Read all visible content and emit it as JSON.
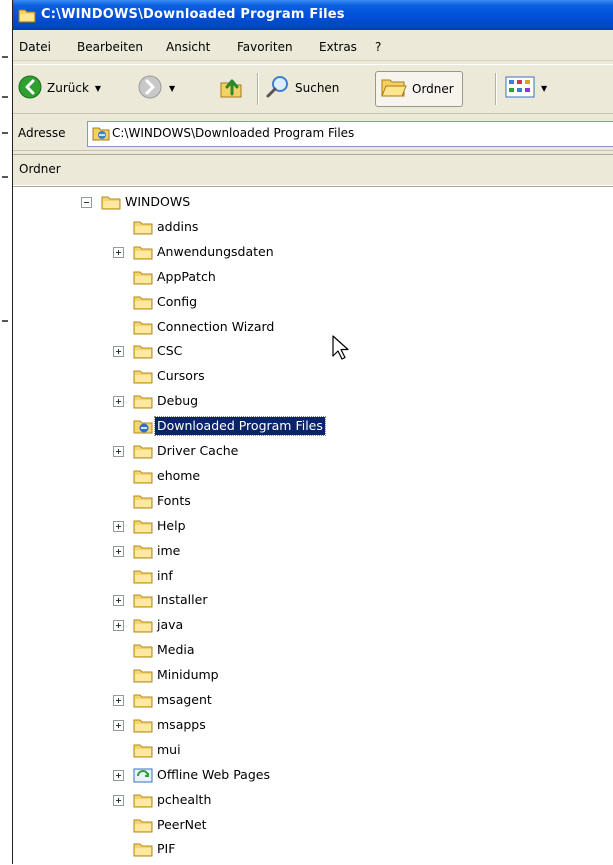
{
  "window": {
    "title": "C:\\WINDOWS\\Downloaded Program Files"
  },
  "menu": [
    "Datei",
    "Bearbeiten",
    "Ansicht",
    "Favoriten",
    "Extras",
    "?"
  ],
  "toolbar": {
    "back_label": "Zurück",
    "search_label": "Suchen",
    "folders_label": "Ordner"
  },
  "address": {
    "label": "Adresse",
    "value": "C:\\WINDOWS\\Downloaded Program Files"
  },
  "folders_pane": {
    "title": "Ordner"
  },
  "tree": [
    {
      "label": "WINDOWS",
      "expander": "minus",
      "icon": "folder-icon",
      "level": 0
    },
    {
      "label": "addins",
      "expander": "none",
      "icon": "folder-icon",
      "level": 1
    },
    {
      "label": "Anwendungsdaten",
      "expander": "plus",
      "icon": "folder-icon",
      "level": 1
    },
    {
      "label": "AppPatch",
      "expander": "none",
      "icon": "folder-icon",
      "level": 1
    },
    {
      "label": "Config",
      "expander": "none",
      "icon": "folder-icon",
      "level": 1
    },
    {
      "label": "Connection Wizard",
      "expander": "none",
      "icon": "folder-icon",
      "level": 1
    },
    {
      "label": "CSC",
      "expander": "plus",
      "icon": "folder-icon",
      "level": 1
    },
    {
      "label": "Cursors",
      "expander": "none",
      "icon": "folder-icon",
      "level": 1
    },
    {
      "label": "Debug",
      "expander": "plus",
      "icon": "folder-icon",
      "level": 1
    },
    {
      "label": "Downloaded Program Files",
      "expander": "none",
      "icon": "ie-folder-icon",
      "level": 1,
      "selected": true
    },
    {
      "label": "Driver Cache",
      "expander": "plus",
      "icon": "folder-icon",
      "level": 1
    },
    {
      "label": "ehome",
      "expander": "none",
      "icon": "folder-icon",
      "level": 1
    },
    {
      "label": "Fonts",
      "expander": "none",
      "icon": "folder-icon",
      "level": 1
    },
    {
      "label": "Help",
      "expander": "plus",
      "icon": "folder-icon",
      "level": 1
    },
    {
      "label": "ime",
      "expander": "plus",
      "icon": "folder-icon",
      "level": 1
    },
    {
      "label": "inf",
      "expander": "none",
      "icon": "folder-icon",
      "level": 1
    },
    {
      "label": "Installer",
      "expander": "plus",
      "icon": "folder-icon",
      "level": 1
    },
    {
      "label": "java",
      "expander": "plus",
      "icon": "folder-icon",
      "level": 1
    },
    {
      "label": "Media",
      "expander": "none",
      "icon": "folder-icon",
      "level": 1
    },
    {
      "label": "Minidump",
      "expander": "none",
      "icon": "folder-icon",
      "level": 1
    },
    {
      "label": "msagent",
      "expander": "plus",
      "icon": "folder-icon",
      "level": 1
    },
    {
      "label": "msapps",
      "expander": "plus",
      "icon": "folder-icon",
      "level": 1
    },
    {
      "label": "mui",
      "expander": "none",
      "icon": "folder-icon",
      "level": 1
    },
    {
      "label": "Offline Web Pages",
      "expander": "plus",
      "icon": "offline-pages-icon",
      "level": 1
    },
    {
      "label": "pchealth",
      "expander": "plus",
      "icon": "folder-icon",
      "level": 1
    },
    {
      "label": "PeerNet",
      "expander": "none",
      "icon": "folder-icon",
      "level": 1
    },
    {
      "label": "PIF",
      "expander": "none",
      "icon": "folder-icon",
      "level": 1
    }
  ],
  "colors": {
    "titlebar": "#0050d8",
    "selection": "#0a246a",
    "chrome": "#ece9d8"
  }
}
